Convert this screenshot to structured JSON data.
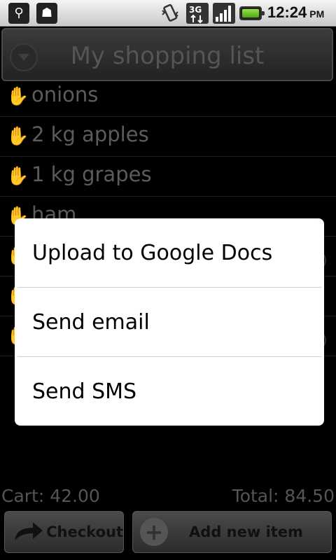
{
  "status_bar": {
    "left_icons": [
      "usb-icon",
      "android-debug-icon"
    ],
    "right_icons": [
      "vibrate-icon",
      "3g-data-icon",
      "signal-strength-icon",
      "battery-icon"
    ],
    "network": "3G",
    "time": "12:24",
    "ampm": "PM"
  },
  "app": {
    "title": "My shopping list",
    "items": [
      {
        "label": "onions"
      },
      {
        "label": "2 kg apples"
      },
      {
        "label": "1 kg grapes"
      },
      {
        "label": "ham"
      },
      {
        "label": ""
      },
      {
        "label": ""
      },
      {
        "label": ""
      }
    ],
    "cart_label": "Cart: 42.00",
    "total_label": "Total: 84.50",
    "checkout_button": "Checkout",
    "add_button": "Add new item"
  },
  "dialog": {
    "options": [
      {
        "label": "Upload to Google Docs"
      },
      {
        "label": "Send email"
      },
      {
        "label": "Send SMS"
      }
    ]
  }
}
